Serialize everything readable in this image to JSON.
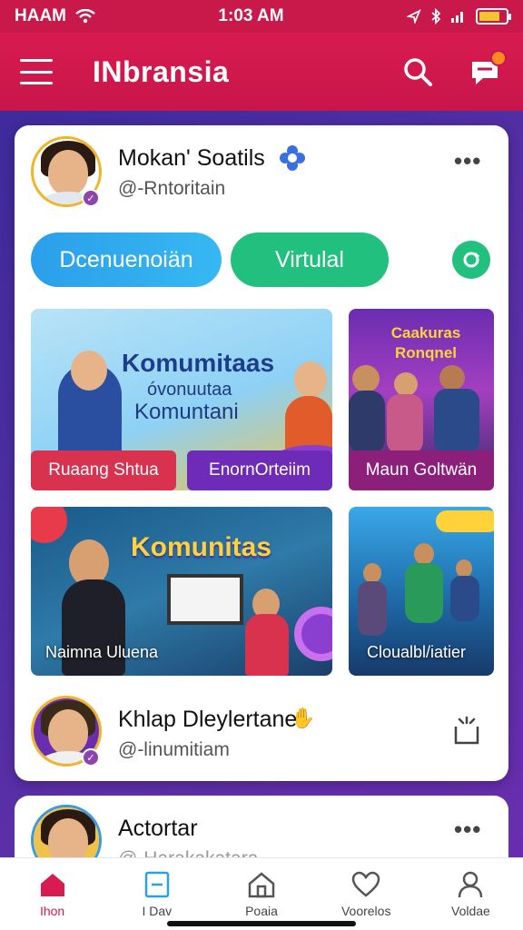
{
  "status_bar": {
    "carrier": "HAAM",
    "time": "1:03 AM"
  },
  "header": {
    "title": "INbransia",
    "icons": [
      "menu-icon",
      "search-icon",
      "chat-icon"
    ]
  },
  "post": {
    "author_name": "Mokan' Soatils",
    "handle": "@-Rntoritain",
    "verified_icon": "verified-badge-icon"
  },
  "chips": {
    "first": "Dcenuenoiän",
    "second": "Virtulal"
  },
  "tiles": {
    "t1": {
      "heading": "Komumitaas",
      "sub1": "óvonuutaa",
      "sub2": "Komuntani",
      "label": "Ruaang Shtua"
    },
    "t1b": {
      "label": "EnornOrteiim"
    },
    "t2": {
      "heading": "Caakuras Ronqnel",
      "label": "Maun Goltwän"
    },
    "t3": {
      "heading": "Komunitas",
      "caption": "Naimna Uluena"
    },
    "t4": {
      "caption": "Cloualbl/iatier"
    }
  },
  "post2": {
    "author_name": "Khlap Dleylertane",
    "handle": "@-linumitiam"
  },
  "post3": {
    "author_name": "Actortar",
    "handle": "@-Harakakatara"
  },
  "bottom_nav": [
    {
      "label": "Ihon",
      "icon": "home-icon",
      "active": true
    },
    {
      "label": "I Dav",
      "icon": "square-icon",
      "active": false
    },
    {
      "label": "Poaia",
      "icon": "house-outline-icon",
      "active": false
    },
    {
      "label": "Voorelos",
      "icon": "heart-icon",
      "active": false
    },
    {
      "label": "Voldae",
      "icon": "user-icon",
      "active": false
    }
  ],
  "colors": {
    "brand": "#d81b50",
    "chip_blue": "#2ba6ee",
    "chip_green": "#22c07e"
  }
}
